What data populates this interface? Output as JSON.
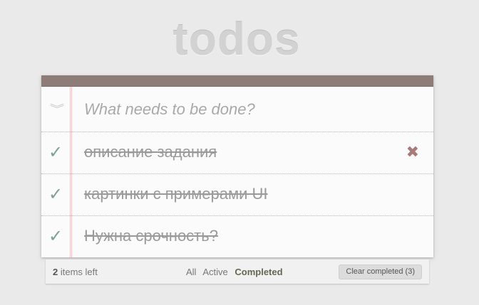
{
  "app": {
    "title": "todos"
  },
  "new_todo": {
    "placeholder": "What needs to be done?",
    "value": ""
  },
  "toggle_all_icon": "chevron-double-down-icon",
  "todos": [
    {
      "label": "описание задания",
      "completed": true
    },
    {
      "label": "картинки с примерами UI",
      "completed": true
    },
    {
      "label": "Нужна срочность?",
      "completed": true
    }
  ],
  "footer": {
    "count": "2",
    "count_suffix": " items left",
    "filters": [
      "All",
      "Active",
      "Completed"
    ],
    "selected_filter": "Completed",
    "clear_label": "Clear completed (3)"
  },
  "colors": {
    "topbar": "#8d7c77",
    "check": "#7ca19a",
    "destroy": "#a87a7a",
    "margin_line": "#f3c7c7"
  }
}
